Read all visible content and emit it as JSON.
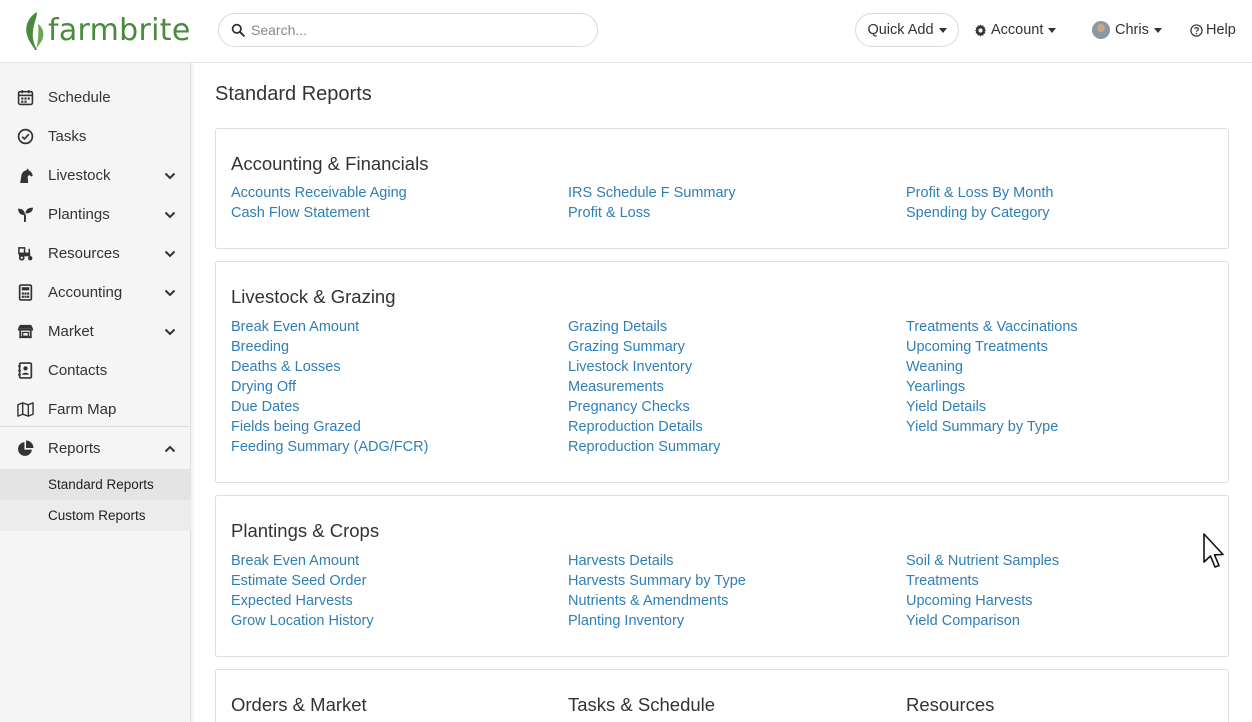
{
  "header": {
    "brand": "farmbrite",
    "search_placeholder": "Search...",
    "quick_add": "Quick Add",
    "account": "Account",
    "user": "Chris",
    "help": "Help"
  },
  "sidebar": {
    "items": [
      {
        "label": "Schedule",
        "icon": "calendar-icon"
      },
      {
        "label": "Tasks",
        "icon": "check-circle-icon"
      },
      {
        "label": "Livestock",
        "icon": "horse-icon"
      },
      {
        "label": "Plantings",
        "icon": "seedling-icon"
      },
      {
        "label": "Resources",
        "icon": "tractor-icon"
      },
      {
        "label": "Accounting",
        "icon": "calculator-icon"
      },
      {
        "label": "Market",
        "icon": "store-icon"
      },
      {
        "label": "Contacts",
        "icon": "address-book-icon"
      },
      {
        "label": "Farm Map",
        "icon": "map-icon"
      },
      {
        "label": "Reports",
        "icon": "pie-chart-icon"
      }
    ],
    "sub_items": [
      {
        "label": "Standard Reports",
        "active": true
      },
      {
        "label": "Custom Reports",
        "active": false
      }
    ]
  },
  "main": {
    "title": "Standard Reports",
    "sections": [
      {
        "title": "Accounting & Financials",
        "columns": [
          [
            "Accounts Receivable Aging",
            "Cash Flow Statement"
          ],
          [
            "IRS Schedule F Summary",
            "Profit & Loss"
          ],
          [
            "Profit & Loss By Month",
            "Spending by Category"
          ]
        ]
      },
      {
        "title": "Livestock & Grazing",
        "columns": [
          [
            "Break Even Amount",
            "Breeding",
            "Deaths & Losses",
            "Drying Off",
            "Due Dates",
            "Fields being Grazed",
            "Feeding Summary (ADG/FCR)"
          ],
          [
            "Grazing Details",
            "Grazing Summary",
            "Livestock Inventory",
            "Measurements",
            "Pregnancy Checks",
            "Reproduction Details",
            "Reproduction Summary"
          ],
          [
            "Treatments & Vaccinations",
            "Upcoming Treatments",
            "Weaning",
            "Yearlings",
            "Yield Details",
            "Yield Summary by Type"
          ]
        ]
      },
      {
        "title": "Plantings & Crops",
        "columns": [
          [
            "Break Even Amount",
            "Estimate Seed Order",
            "Expected Harvests",
            "Grow Location History"
          ],
          [
            "Harvests Details",
            "Harvests Summary by Type",
            "Nutrients & Amendments",
            "Planting Inventory"
          ],
          [
            "Soil & Nutrient Samples",
            "Treatments",
            "Upcoming Harvests",
            "Yield Comparison"
          ]
        ]
      }
    ],
    "bottom_titles": [
      "Orders & Market",
      "Tasks & Schedule",
      "Resources"
    ]
  },
  "colors": {
    "brand_green": "#4a8a3c",
    "link_blue": "#2f7fb4",
    "sidebar_bg": "#f5f5f5"
  }
}
